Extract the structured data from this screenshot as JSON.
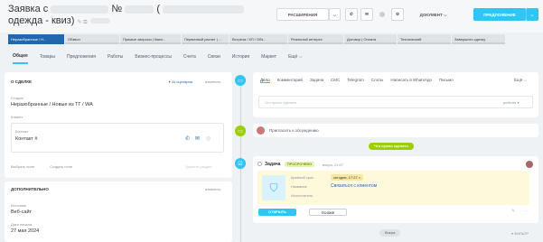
{
  "header": {
    "title_line1": "Заявка с",
    "title_no": "№",
    "title_paren": "(",
    "title_line2": "одежда - квиз)",
    "edit_icons": "✎ ⧉",
    "btn_extensions": "РАСШИРЕНИЯ",
    "btn_document": "ДОКУМЕНТ",
    "btn_offer": "ПРЕДЛОЖЕНИЕ"
  },
  "stages": [
    {
      "label": "Неразобранные / Н...",
      "active": true
    },
    {
      "label": "Обзвон",
      "active": false
    },
    {
      "label": "Прямые запросы | Квал...",
      "active": false
    },
    {
      "label": "Первичный расчет | ...",
      "active": false
    },
    {
      "label": "Встреча / КП / Обз...",
      "active": false
    },
    {
      "label": "Реальный интерес",
      "active": false
    },
    {
      "label": "Договор | Оплата",
      "active": false
    },
    {
      "label": "Технический",
      "active": false
    },
    {
      "label": "Завершить сделку",
      "active": false
    }
  ],
  "tabs": [
    "Общее",
    "Товары",
    "Предложения",
    "Работы",
    "Бизнес-процессы",
    "Счета",
    "Связи",
    "История",
    "Маркет",
    "Ещё ⌵"
  ],
  "about": {
    "header": "О СДЕЛКЕ",
    "ai": "✦ AI-сценарии",
    "change": "изменить",
    "stage_label": "Стадия",
    "stage_value": "Неразобранные / Новые из ТГ / WA",
    "client_label": "Клиент",
    "contact_label": "Контакт",
    "contact_value": "Контакт #",
    "select_field": "Выбрать поле",
    "create_field": "Создать поле",
    "delete_section": "Удалить раздел"
  },
  "more": {
    "header": "ДОПОЛНИТЕЛЬНО",
    "change": "изменить",
    "source_label": "Источник",
    "source_value": "Веб-сайт",
    "date_label": "Дата начала",
    "date_value": "27 мая 2024"
  },
  "activity": {
    "tabs": [
      "Дело",
      "Комментарий",
      "Задача",
      "СМС",
      "Telegram",
      "Слоты",
      "Написать в WhatsApp",
      "Письмо",
      "Ещё ⌵"
    ],
    "placeholder": "Что нужно сделать",
    "invite": "Пригласить к обсуждению",
    "todo_badge": "Что нужно сделать",
    "task_title": "Задача",
    "task_badge": "ПРОСРОЧЕНО",
    "task_time": "вчера, 21:07",
    "deadline_label": "Крайний срок",
    "deadline_value": "сегодня, 17:27 ×",
    "name_label": "Название",
    "name_value": "Связаться с клиентом",
    "executor_label": "Исполнитель",
    "btn_open": "ОТКРЫТЬ",
    "btn_later": "ПОЗЖЕ",
    "yesterday": "Вчера",
    "filter": "▾ ФИЛЬТР",
    "responsible": "рейтинг ▾"
  },
  "colors": {
    "accent": "#2fc6f6",
    "stage_active": "#2067b0",
    "green": "#9dcf00",
    "task_bg": "#fff9dc"
  }
}
